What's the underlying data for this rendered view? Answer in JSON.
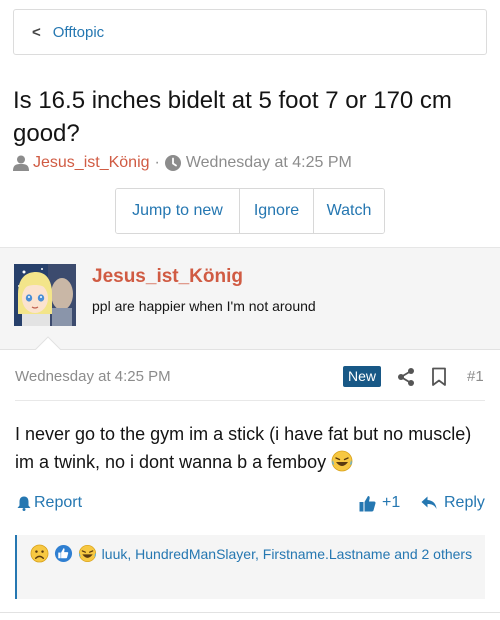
{
  "breadcrumb": {
    "label": "Offtopic"
  },
  "thread": {
    "title": "Is 16.5 inches bidelt at 5 foot 7 or 170 cm good?",
    "author": "Jesus_ist_König",
    "separator": "·",
    "date": "Wednesday at 4:25 PM"
  },
  "buttons": {
    "jump_to_new": "Jump to new",
    "ignore": "Ignore",
    "watch": "Watch"
  },
  "post": {
    "username": "Jesus_ist_König",
    "user_status": "ppl are happier when I'm not around",
    "date": "Wednesday at 4:25 PM",
    "badge": "New",
    "number": "#1",
    "body": "I never go to the gym im a stick (i have fat but no muscle) im a twink, no i dont wanna b a femboy",
    "report_label": "Report",
    "like_count": "+1",
    "reply_label": "Reply",
    "reactions_text": "luuk, HundredManSlayer, Firstname.Lastname and 2 others"
  },
  "colors": {
    "link": "#2577b1",
    "username": "#d05b43",
    "muted": "#8c8c8c",
    "badge_bg": "#185886"
  },
  "icons": [
    "chevron-left-icon",
    "user-icon",
    "clock-icon",
    "share-icon",
    "bookmark-icon",
    "warning-bell-icon",
    "thumbs-up-icon",
    "reply-arrow-icon",
    "sad-face-icon",
    "like-reaction-icon",
    "laugh-cry-emoji-icon"
  ]
}
